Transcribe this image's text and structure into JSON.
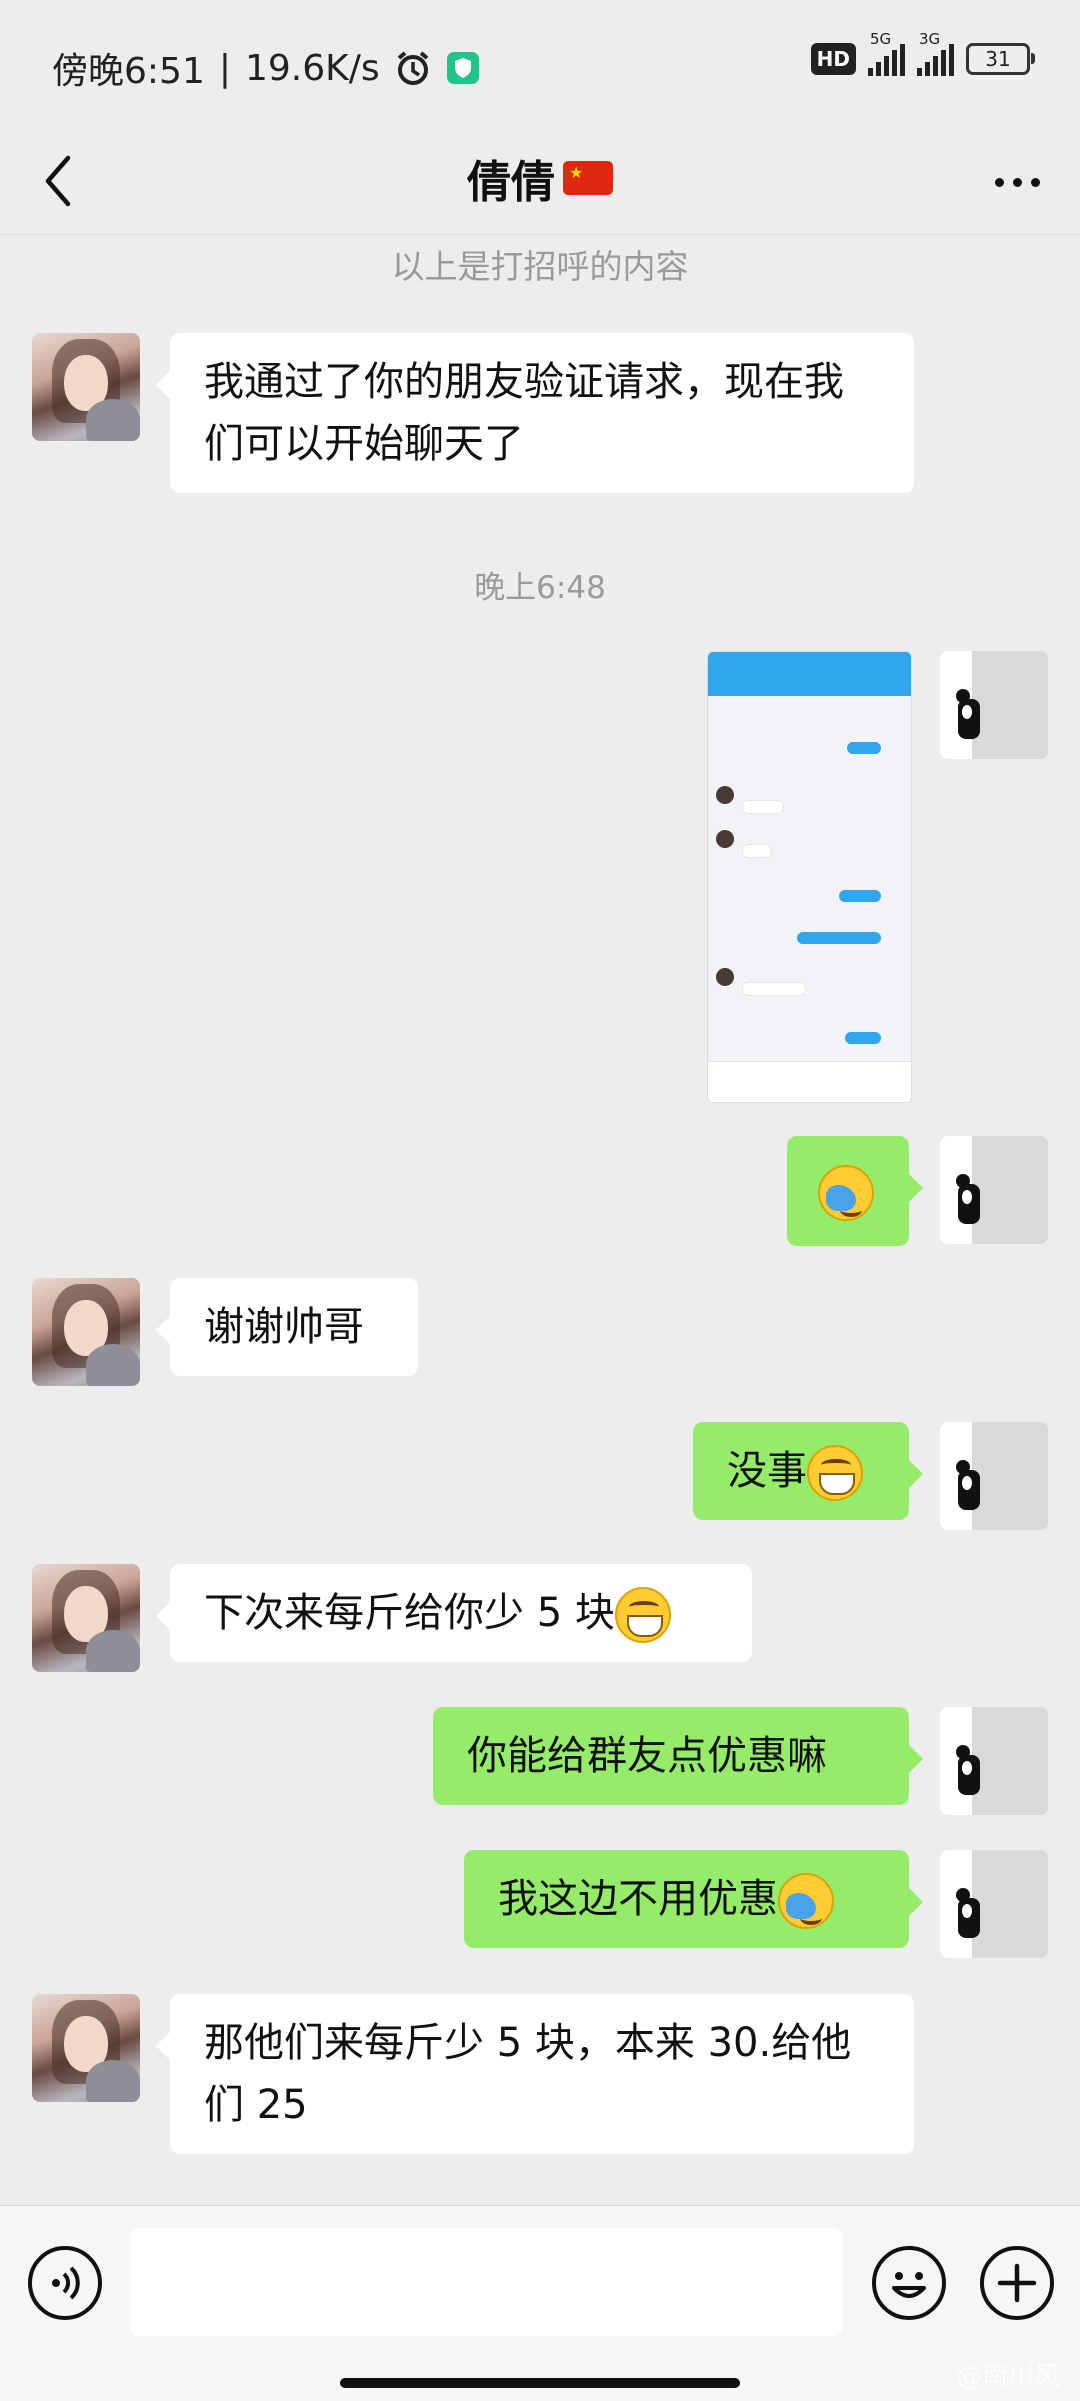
{
  "status_bar": {
    "time": "傍晚6:51",
    "net_speed": "19.6K/s",
    "hd": "HD",
    "sig1_label": "5G",
    "sig2_label": "3G",
    "battery": "31"
  },
  "header": {
    "title": "倩倩"
  },
  "chat": {
    "system_note": "以上是打招呼的内容",
    "timestamp": "晚上6:48",
    "messages": [
      {
        "side": "in",
        "text": "我通过了你的朋友验证请求，现在我们可以开始聊天了"
      },
      {
        "side": "out",
        "type": "image"
      },
      {
        "side": "out",
        "type": "emoji",
        "emoji": "facepalm"
      },
      {
        "side": "in",
        "text": "谢谢帅哥"
      },
      {
        "side": "out",
        "text": "没事",
        "emoji": "grin"
      },
      {
        "side": "in",
        "text": "下次来每斤给你少 5 块",
        "emoji": "grin"
      },
      {
        "side": "out",
        "text": "你能给群友点优惠嘛"
      },
      {
        "side": "out",
        "text": "我这边不用优惠",
        "emoji": "facepalm"
      },
      {
        "side": "in",
        "text": "那他们来每斤少 5 块，本来 30.给他们 25"
      }
    ]
  },
  "watermark": "@南川风"
}
